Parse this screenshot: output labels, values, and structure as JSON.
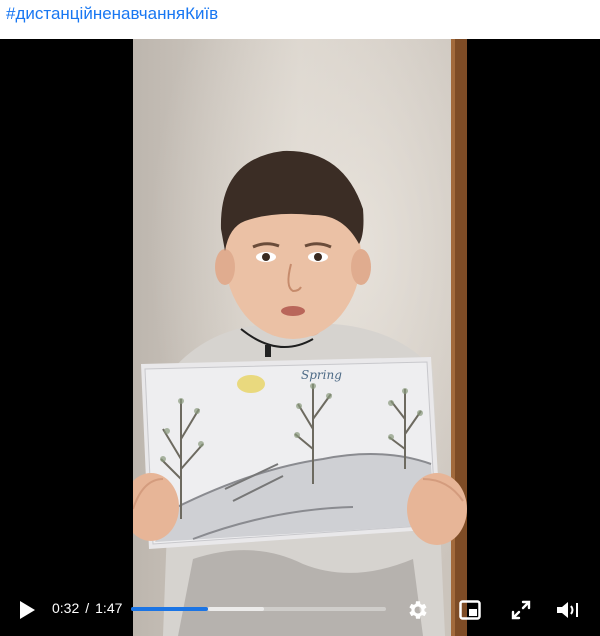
{
  "post": {
    "hashtag": "#дистанційненавчанняКиїв"
  },
  "drawing": {
    "label": "Spring"
  },
  "player": {
    "current_time": "0:32",
    "separator": "/",
    "duration": "1:47",
    "progress_fraction": 0.3,
    "buffered_fraction": 0.52,
    "accent_color": "#1b74e4",
    "icons": [
      "play-icon",
      "gear-icon",
      "picture-in-picture-icon",
      "fullscreen-icon",
      "volume-icon"
    ]
  }
}
